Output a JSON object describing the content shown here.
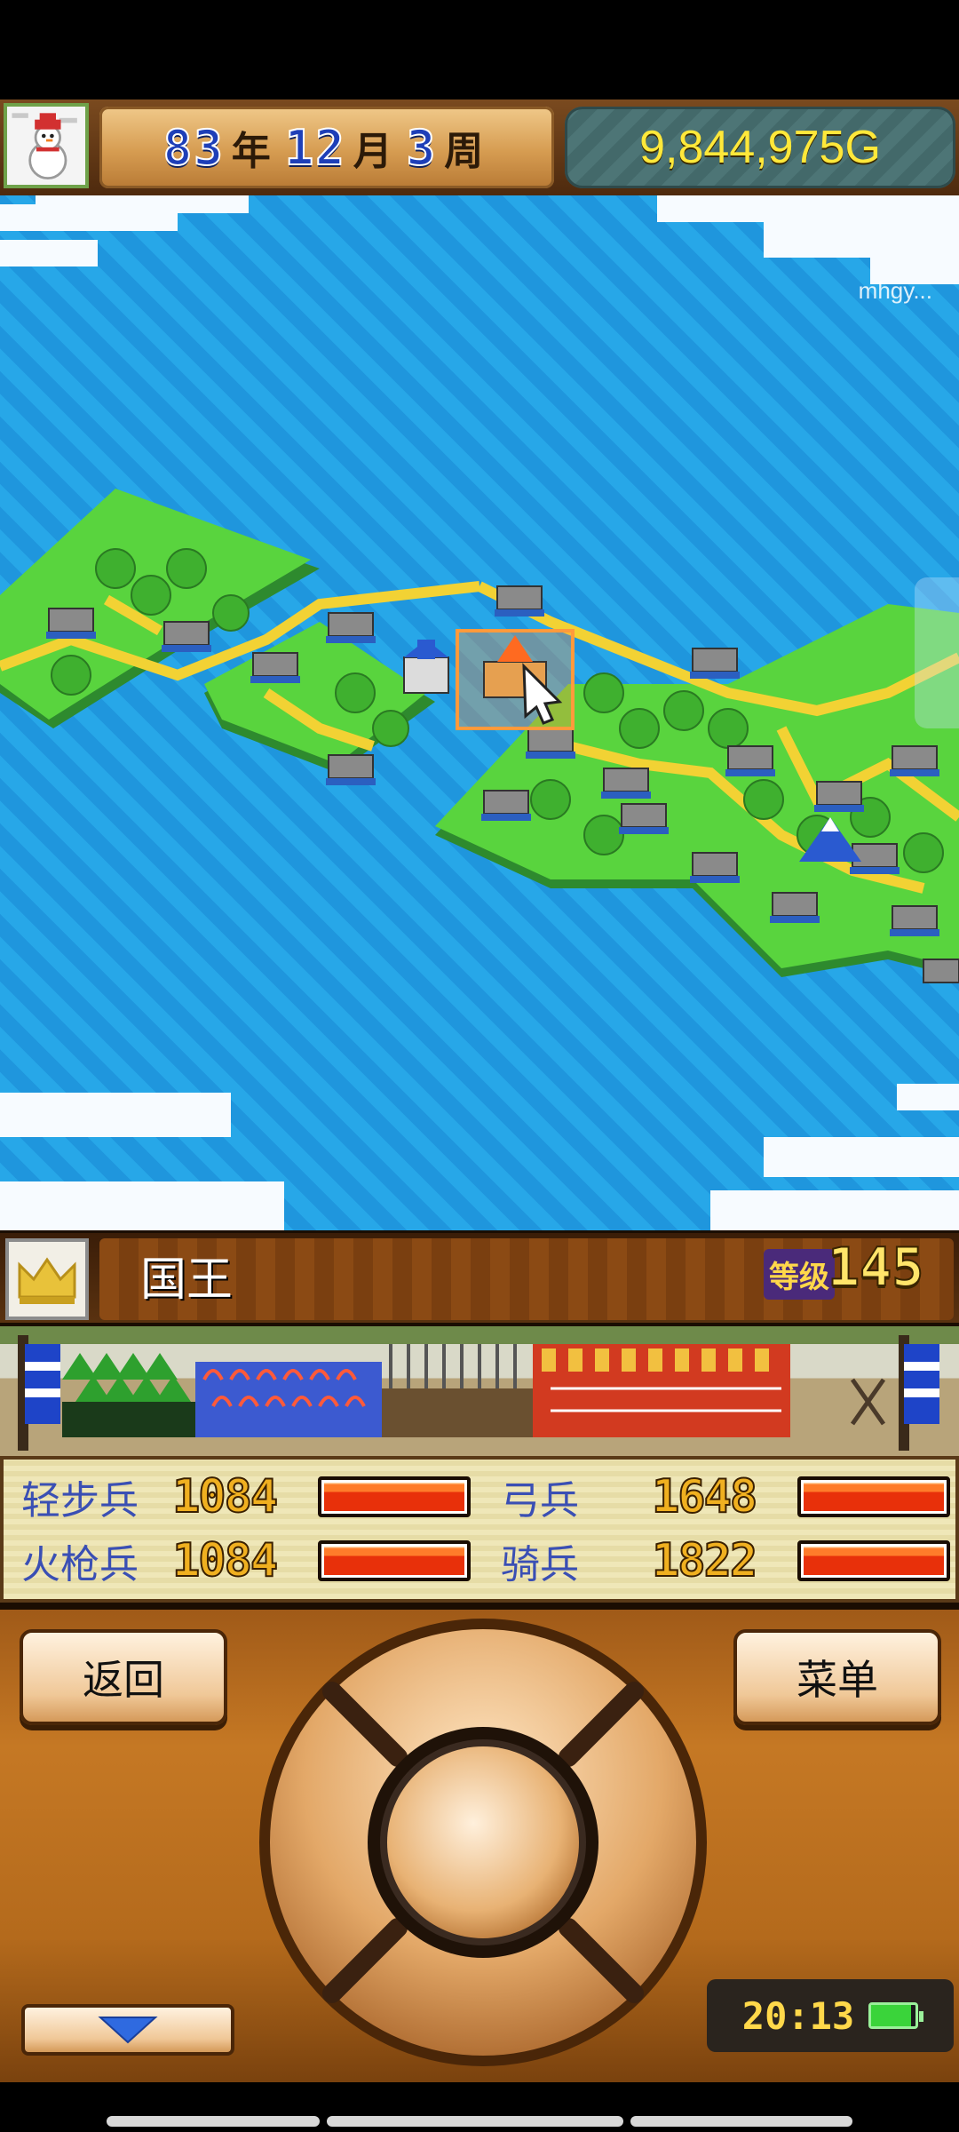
{
  "header": {
    "year": "83",
    "year_unit": "年",
    "month": "12",
    "month_unit": "月",
    "week": "3",
    "week_unit": "周",
    "gold": "9,844,975G"
  },
  "map": {
    "watermark": "mhgy..."
  },
  "rank": {
    "title": "国王",
    "level_label": "等级",
    "level": "145"
  },
  "troops": [
    {
      "name": "轻步兵",
      "count": "1084",
      "fill": 1.0
    },
    {
      "name": "弓兵",
      "count": "1648",
      "fill": 1.0
    },
    {
      "name": "火枪兵",
      "count": "1084",
      "fill": 1.0
    },
    {
      "name": "骑兵",
      "count": "1822",
      "fill": 1.0
    }
  ],
  "controls": {
    "back_label": "返回",
    "menu_label": "菜单"
  },
  "status": {
    "clock": "20:13",
    "battery_level": 0.9
  },
  "colors": {
    "accent_gold": "#ffe83a",
    "date_blue": "#1e3fb8",
    "troop_name_blue": "#3a4fb4",
    "bar_red": "#e8300a"
  },
  "icons": {
    "avatar": "snowman-avatar-icon",
    "crown": "crown-icon",
    "scroll_down": "triangle-down-icon",
    "battery": "battery-icon"
  }
}
